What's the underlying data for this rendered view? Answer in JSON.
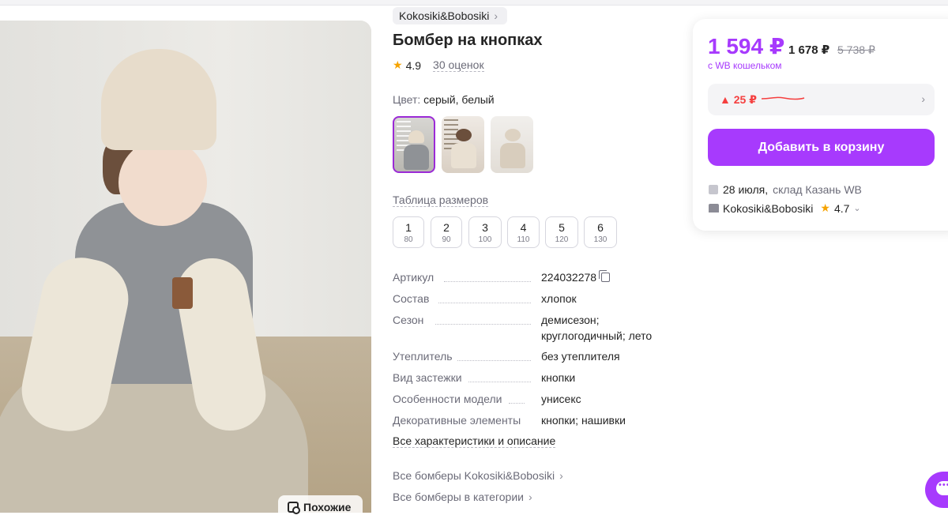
{
  "product": {
    "brand": "Kokosiki&Bobosiki",
    "title": "Бомбер на кнопках",
    "rating": "4.9",
    "reviews": "30 оценок",
    "color_label": "Цвет:",
    "color_value": " серый, белый",
    "similar_label": "Похожие",
    "size_table_label": "Таблица размеров",
    "sizes": [
      {
        "size": "1",
        "height": "80"
      },
      {
        "size": "2",
        "height": "90"
      },
      {
        "size": "3",
        "height": "100"
      },
      {
        "size": "4",
        "height": "110"
      },
      {
        "size": "5",
        "height": "120"
      },
      {
        "size": "6",
        "height": "130"
      }
    ],
    "specs": [
      {
        "name": "Артикул",
        "value": "224032278"
      },
      {
        "name": "Состав",
        "value": "хлопок"
      },
      {
        "name": "Сезон",
        "value": "демисезон;",
        "value2": "круглогодичный; лето"
      },
      {
        "name": "Утеплитель",
        "value": "без утеплителя"
      },
      {
        "name": "Вид застежки",
        "value": "кнопки"
      },
      {
        "name": "Особенности модели",
        "value": "унисекс"
      },
      {
        "name": "Декоративные элементы",
        "value": "кнопки; нашивки"
      }
    ],
    "all_characteristics": "Все характеристики и описание",
    "links": [
      "Все бомберы Kokosiki&Bobosiki",
      "Все бомберы в категории"
    ]
  },
  "price_card": {
    "price": "1 594 ₽",
    "price_mid": "1 678 ₽",
    "price_old": "5 738 ₽",
    "wallet_note": "с WB кошельком",
    "price_delta": "▲ 25 ₽",
    "add_to_cart": "Добавить в корзину",
    "delivery_date": "28 июля,",
    "delivery_place": "склад Казань WB",
    "seller_name": "Kokosiki&Bobosiki",
    "seller_rating": "4.7"
  },
  "colors": {
    "accent": "#a73afd",
    "price_up": "#f53f3f",
    "star": "#f6a300"
  }
}
